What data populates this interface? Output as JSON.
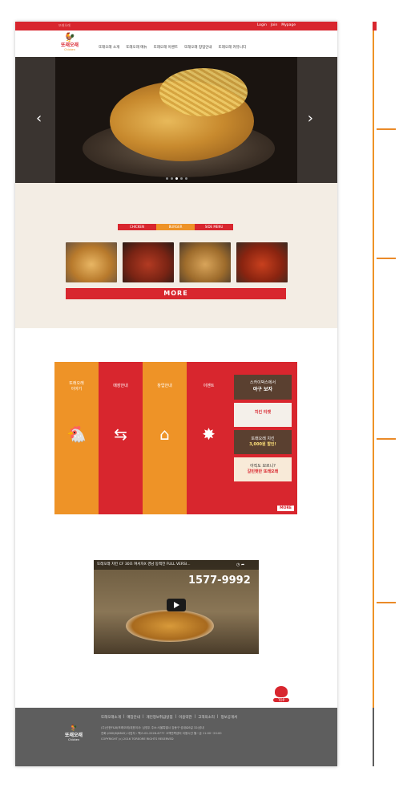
{
  "topbar": {
    "logo_mini": "또래오래",
    "links": [
      "Login",
      "Join",
      "Mypage"
    ]
  },
  "brand": {
    "name": "또래오래",
    "sub": "Chicken",
    "icon": "rooster-icon"
  },
  "nav": {
    "items": [
      "또래오래 소개",
      "또래오래 메뉴",
      "또래오래 이벤트",
      "또래오래 창업안내",
      "또래오래 커뮤니티"
    ]
  },
  "hero": {
    "prev_icon": "chevron-left-icon",
    "next_icon": "chevron-right-icon",
    "prev": "‹",
    "next": "›",
    "active_slide": 2,
    "slide_count": 5
  },
  "menu": {
    "tabs": [
      "CHICKEN",
      "BURGER",
      "SIDE MENU"
    ],
    "active_tab": 1,
    "more_label": "MORE"
  },
  "quick": {
    "columns": [
      {
        "label": "또래오래\n이야기",
        "icon": "chicken-icon",
        "color": "#ee9327"
      },
      {
        "label": "매장안내",
        "icon": "signpost-icon",
        "color": "#d8262e"
      },
      {
        "label": "창업안내",
        "icon": "store-icon",
        "color": "#ee9327"
      },
      {
        "label": "이벤트",
        "icon": "fireworks-icon",
        "color": "#d8262e"
      }
    ],
    "banners": [
      {
        "line1": "스카이박스에서",
        "line2": "야구 보자",
        "bg": "#5a4030",
        "fg": "#ffffff"
      },
      {
        "line1": "치킨 티켓",
        "line2": "",
        "bg": "#f4f0ea",
        "fg": "#d8262e"
      },
      {
        "line1": "또래오래 치킨",
        "line2": "3,000원 할인!",
        "bg": "#5a4030",
        "fg": "#ffe27a"
      },
      {
        "line1": "아직도 모르니?",
        "line2": "갈빈햇반 또래오래",
        "bg": "#f8ead8",
        "fg": "#d8262e"
      }
    ],
    "more_label": "MORE"
  },
  "video": {
    "title": "또래오래 치킨 CF 30초 여서자X 경남 동백전 FULL VERSI...",
    "phone": "1577-9992",
    "controls": "◷ ➦"
  },
  "top_button": {
    "label": "TOP"
  },
  "footer": {
    "logo": "또래오래",
    "logo_sub": "Chicken",
    "links": [
      "또래오래소개",
      "매장안내",
      "개인정보취급방침",
      "이용약관",
      "고객의소리",
      "정보공개서"
    ],
    "separator": "|",
    "info_line1": "(주)신한F&B(또래오래)대표이사: 심영두 주소:서울특별시 강동구 성내로6길 32(성내",
    "info_line2": "전화:(080)8(8845) 사업자 : 팩스:02-2226-6777 고객만족센터 이용시간 월~금 11:00~20:00",
    "copyright": "COPYRIGHT (c) 2016 TOREORE RIGHTS RESERVED"
  },
  "colors": {
    "red": "#d8262e",
    "orange": "#ee9327",
    "cream": "#f3ede4",
    "footer": "#5e5e5e"
  }
}
